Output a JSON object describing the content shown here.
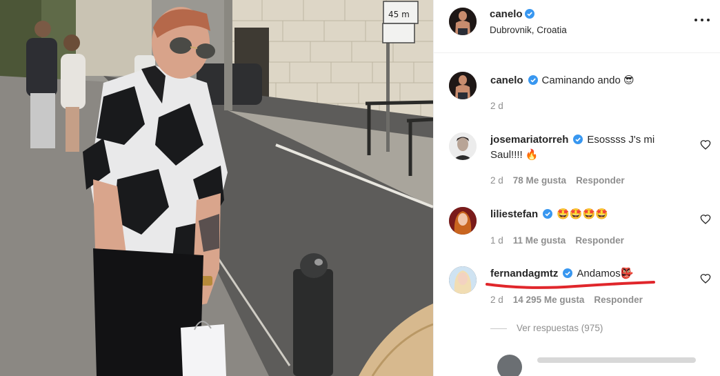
{
  "post": {
    "username": "canelo",
    "location": "Dubrovnik, Croatia",
    "more_icon": "more-horizontal-icon",
    "sign_text": "45 m"
  },
  "caption": {
    "username": "canelo",
    "text": "Caminando ando 😎",
    "time": "2 d"
  },
  "comments": [
    {
      "username": "josemariatorreh",
      "text": "Esossss J's mi Saul!!!! 🔥",
      "time": "2 d",
      "likes": "78 Me gusta",
      "reply_label": "Responder"
    },
    {
      "username": "liliestefan",
      "text": "🤩🤩🤩🤩",
      "time": "1 d",
      "likes": "11 Me gusta",
      "reply_label": "Responder"
    },
    {
      "username": "fernandagmtz",
      "text": "Andamos👺",
      "time": "2 d",
      "likes": "14 295 Me gusta",
      "reply_label": "Responder"
    }
  ],
  "view_replies": "Ver respuestas (975)",
  "colors": {
    "verified": "#3897f0",
    "muted": "#8e8e8e",
    "highlight": "#e0262b"
  }
}
